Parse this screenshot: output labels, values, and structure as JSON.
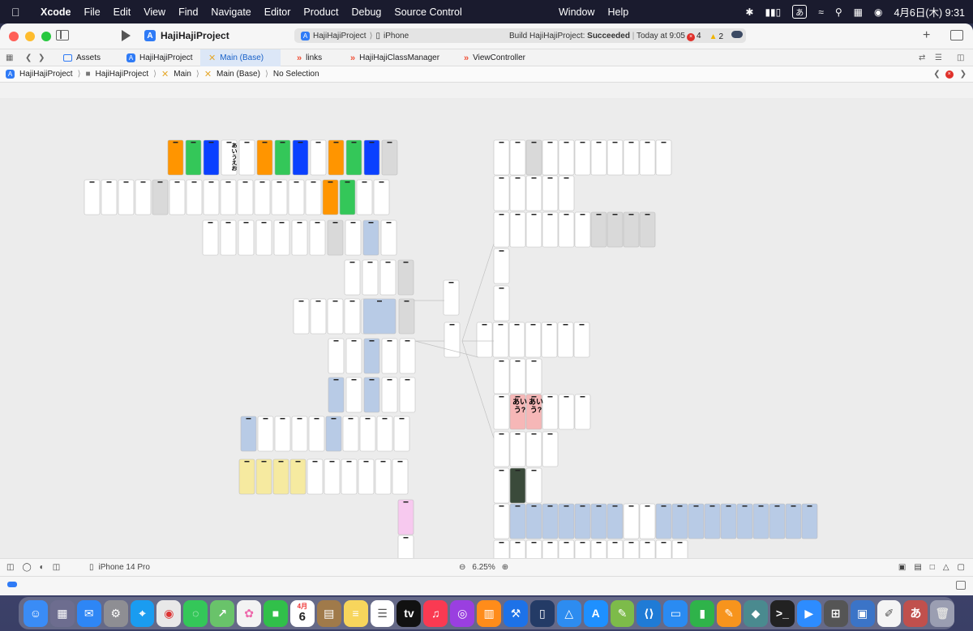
{
  "menubar": {
    "app_name": "Xcode",
    "menus": [
      "File",
      "Edit",
      "View",
      "Find",
      "Navigate",
      "Editor",
      "Product",
      "Debug",
      "Source Control"
    ],
    "menus_right": [
      "Window",
      "Help"
    ],
    "input_source": "あ",
    "clock": "4月6日(木)  9:31"
  },
  "toolbar": {
    "project_name": "HajiHajiProject",
    "scheme_name": "HajiHajiProject",
    "destination": "iPhone",
    "build_status_prefix": "Build HajiHajiProject:",
    "build_status_result": "Succeeded",
    "build_status_time": "Today at 9:05",
    "error_count": "4",
    "warning_count": "2"
  },
  "tabs": [
    {
      "label": "Assets",
      "icon": "asset-catalog-icon"
    },
    {
      "label": "HajiHajiProject",
      "icon": "project-icon"
    },
    {
      "label": "Main (Base)",
      "icon": "storyboard-icon",
      "active": true
    },
    {
      "label": "links",
      "icon": "swift-file-icon"
    },
    {
      "label": "HajiHajiClassManager",
      "icon": "swift-file-icon"
    },
    {
      "label": "ViewController",
      "icon": "swift-file-icon"
    }
  ],
  "breadcrumb": {
    "items": [
      "HajiHajiProject",
      "HajiHajiProject",
      "Main",
      "Main (Base)",
      "No Selection"
    ]
  },
  "canvas": {
    "screen_text_1": "あいうえお",
    "screen_text_2": "あいう?"
  },
  "bottombar": {
    "device": "iPhone 14 Pro",
    "zoom": "6.25%"
  },
  "dock": {
    "calendar_date": "6",
    "calendar_month": "4月",
    "apps": [
      "Finder",
      "Launchpad",
      "Mail",
      "System Settings",
      "Safari",
      "Chrome",
      "Messages",
      "Maps",
      "Photos",
      "FaceTime",
      "Calendar",
      "Notes Brown",
      "Notes",
      "Reminders",
      "TV",
      "Music",
      "Podcasts",
      "Books",
      "Xcode",
      "Simulator",
      "Instruments",
      "App Store",
      "Script Editor",
      "VS Code",
      "Keynote",
      "Numbers",
      "Pages",
      "Sketch",
      "Terminal",
      "Zoom",
      "Calculator",
      "Preview",
      "TextEdit",
      "Kotoeri",
      "Trash"
    ],
    "colors": {
      "accent": "#2f7bf6"
    }
  },
  "colors": {
    "accent": "#2f7bf6",
    "error": "#e0302a",
    "warning": "#f0b400",
    "success_green": "#34c759",
    "orange": "#ff9500",
    "blue": "#0a40ff"
  }
}
